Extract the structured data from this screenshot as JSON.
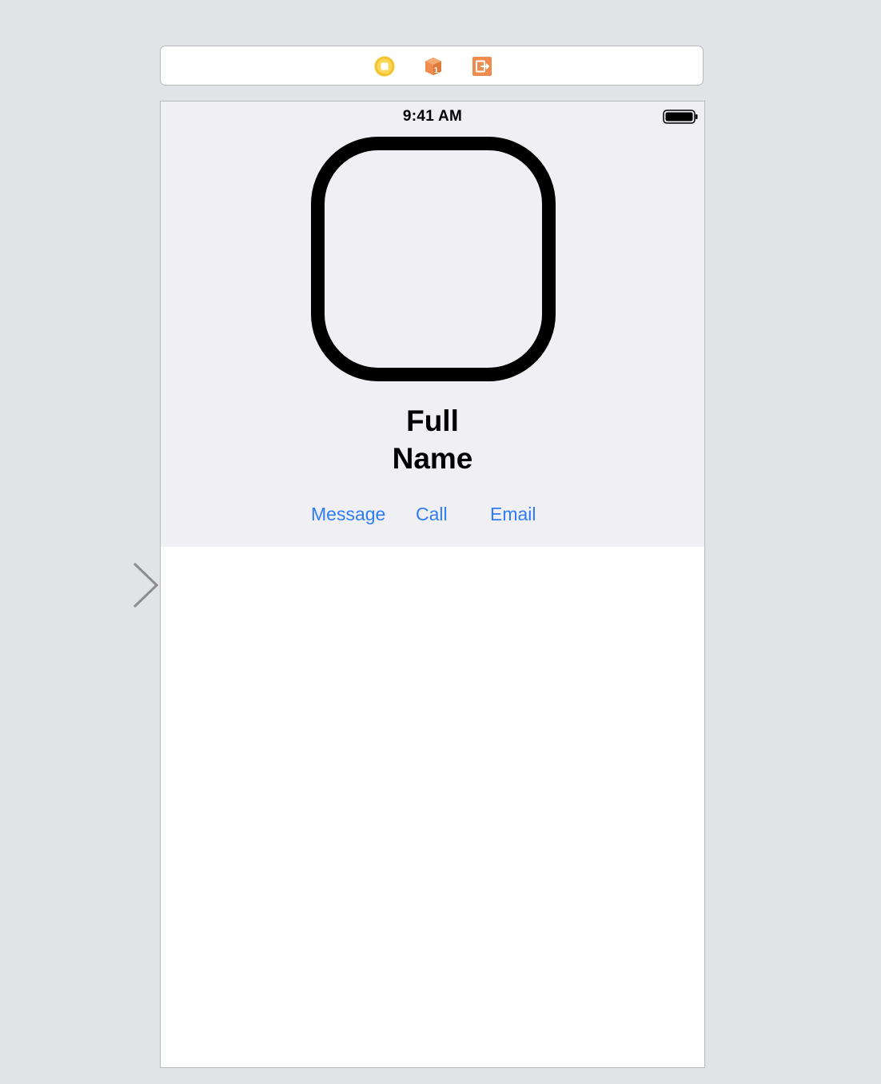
{
  "dock": {
    "icons": [
      "view-controller-icon",
      "first-responder-icon",
      "exit-icon"
    ],
    "colors": {
      "view_controller": "#f5c22b",
      "first_responder": "#ee8c4d",
      "exit": "#ee8c4d"
    }
  },
  "status_bar": {
    "time": "9:41 AM",
    "battery_level": 1.0
  },
  "profile": {
    "name_line1": "Full",
    "name_line2": "Name"
  },
  "actions": {
    "message_label": "Message",
    "call_label": "Call",
    "email_label": "Email"
  },
  "colors": {
    "accent": "#2f7df6",
    "header_background": "#efeff4",
    "canvas_background": "#e2e3e6"
  }
}
